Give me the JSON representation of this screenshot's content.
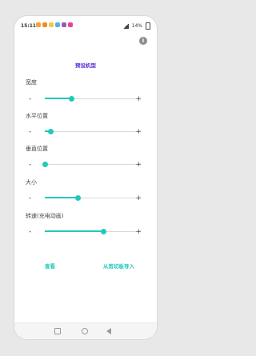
{
  "status": {
    "time": "15:11",
    "icon_colors": [
      "#f4a336",
      "#f08a2b",
      "#f5c842",
      "#5dade2",
      "#9b59b6",
      "#e84393"
    ],
    "battery": "14%"
  },
  "header": {
    "info_icon": "info-icon"
  },
  "page": {
    "title": "预设机型"
  },
  "settings": [
    {
      "label": "宽度",
      "minus": "-",
      "plus": "+",
      "level": 0.28
    },
    {
      "label": "水平位置",
      "minus": "-",
      "plus": "+",
      "level": 0.06
    },
    {
      "label": "垂直位置",
      "minus": "-",
      "plus": "+",
      "level": 0.0
    },
    {
      "label": "大小",
      "minus": "-",
      "plus": "+",
      "level": 0.35
    },
    {
      "label": "转速(充电动画)",
      "minus": "-",
      "plus": "+",
      "level": 0.62
    }
  ],
  "actions": {
    "view": "查看",
    "import": "从剪切板导入"
  },
  "navigation": {
    "recent": "recent-apps-icon",
    "home": "home-icon",
    "back": "back-icon"
  },
  "colors": {
    "accent": "#20c9ba",
    "title": "#5a2fd4"
  }
}
